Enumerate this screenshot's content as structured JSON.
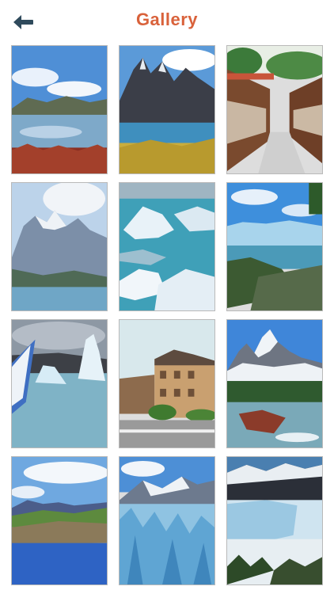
{
  "header": {
    "title": "Gallery",
    "title_color": "#d9623b",
    "back_icon": "arrow-left-icon"
  },
  "gallery": {
    "photos": [
      {
        "subject": "lake-reflection"
      },
      {
        "subject": "torres-del-paine-peaks"
      },
      {
        "subject": "craft-market-walkway"
      },
      {
        "subject": "snowy-mountain-lake"
      },
      {
        "subject": "ice-floes"
      },
      {
        "subject": "glacier-lake-shore"
      },
      {
        "subject": "iceberg-with-boat"
      },
      {
        "subject": "hotel-building"
      },
      {
        "subject": "fitz-roy-river"
      },
      {
        "subject": "coastal-cliffs"
      },
      {
        "subject": "glacier-ice-wall"
      },
      {
        "subject": "glacier-front"
      }
    ]
  }
}
